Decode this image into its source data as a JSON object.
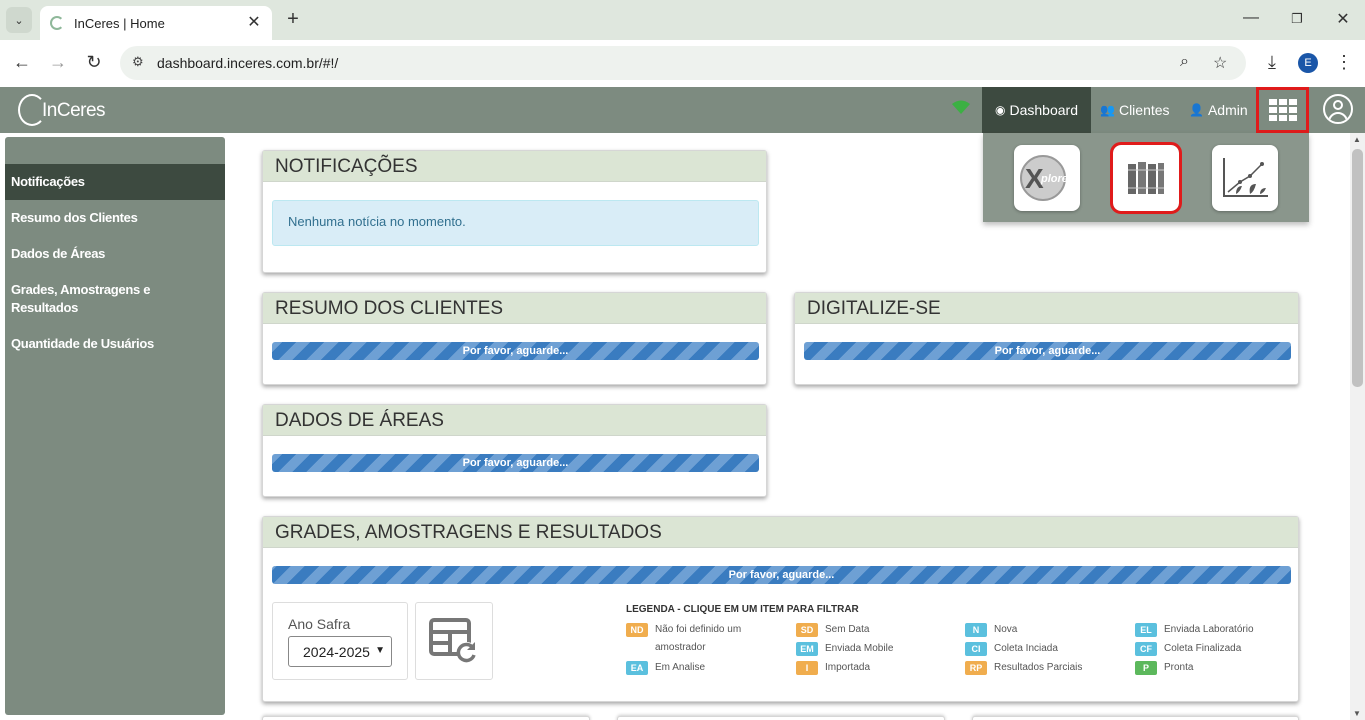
{
  "browser": {
    "tab_title": "InCeres | Home",
    "url": "dashboard.inceres.com.br/#!/",
    "profile_initial": "E"
  },
  "app": {
    "logo_text": "InCeres",
    "nav": {
      "dashboard": "Dashboard",
      "clientes": "Clientes",
      "admin": "Admin"
    },
    "apps_menu": [
      "Xplorer",
      "Library",
      "Growth analytics"
    ]
  },
  "sidebar": {
    "items": [
      {
        "label": "Notificações"
      },
      {
        "label": "Resumo dos Clientes"
      },
      {
        "label": "Dados de Áreas"
      },
      {
        "label": "Grades, Amostragens e Resultados"
      },
      {
        "label": "Quantidade de Usuários"
      }
    ]
  },
  "panels": {
    "notificacoes": {
      "title": "NOTIFICAÇÕES",
      "message": "Nenhuma notícia no momento."
    },
    "resumo": {
      "title": "RESUMO DOS CLIENTES",
      "loading": "Por favor, aguarde..."
    },
    "digitalize": {
      "title": "DIGITALIZE-SE",
      "loading": "Por favor, aguarde..."
    },
    "dados": {
      "title": "DADOS DE ÁREAS",
      "loading": "Por favor, aguarde..."
    },
    "grades": {
      "title": "GRADES, AMOSTRAGENS E RESULTADOS",
      "loading": "Por favor, aguarde...",
      "safra_label": "Ano Safra",
      "safra_value": "2024-2025",
      "legend_title": "LEGENDA - CLIQUE EM UM ITEM PARA FILTRAR",
      "legend": [
        {
          "code": "ND",
          "label": "Não foi definido um amostrador",
          "color": "#f0ad4e"
        },
        {
          "code": "SD",
          "label": "Sem Data",
          "color": "#f0ad4e"
        },
        {
          "code": "N",
          "label": "Nova",
          "color": "#5bc0de"
        },
        {
          "code": "EL",
          "label": "Enviada Laboratório",
          "color": "#5bc0de"
        },
        {
          "code": "EM",
          "label": "Enviada Mobile",
          "color": "#5bc0de"
        },
        {
          "code": "CI",
          "label": "Coleta Inciada",
          "color": "#5bc0de"
        },
        {
          "code": "CF",
          "label": "Coleta Finalizada",
          "color": "#5bc0de"
        },
        {
          "code": "EA",
          "label": "Em Analise",
          "color": "#5bc0de"
        },
        {
          "code": "I",
          "label": "Importada",
          "color": "#f0ad4e"
        },
        {
          "code": "RP",
          "label": "Resultados Parciais",
          "color": "#f0ad4e"
        },
        {
          "code": "P",
          "label": "Pronta",
          "color": "#5cb85c"
        }
      ]
    }
  }
}
